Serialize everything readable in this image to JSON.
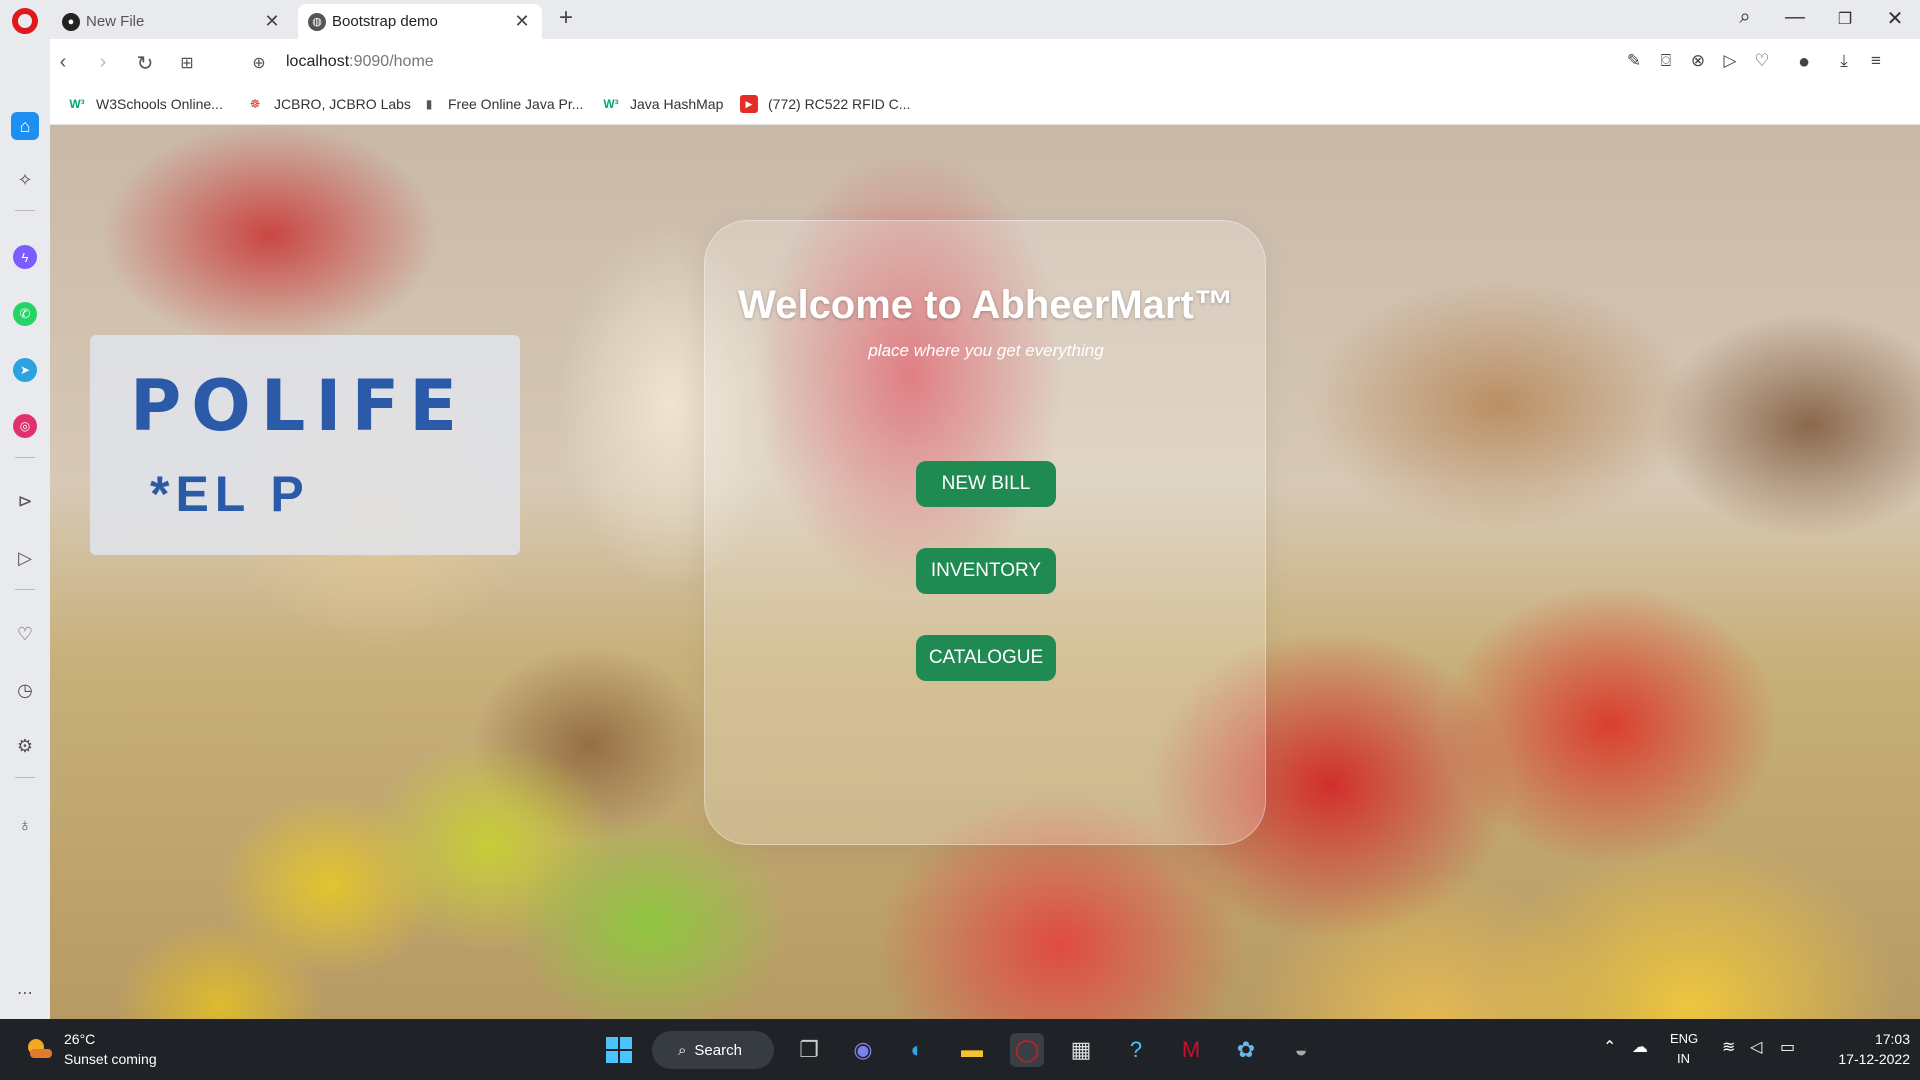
{
  "browser": {
    "tabs": [
      {
        "title": "New File",
        "icon": "github-icon"
      },
      {
        "title": "Bootstrap demo",
        "icon": "globe-icon"
      }
    ],
    "url_host": "localhost",
    "url_path": ":9090/home"
  },
  "bookmarks": [
    {
      "label": "W3Schools Online...",
      "icon": "w3schools-icon"
    },
    {
      "label": "JCBRO, JCBRO Labs",
      "icon": "jcbro-icon"
    },
    {
      "label": "Free Online Java Pr...",
      "icon": "page-icon"
    },
    {
      "label": "Java HashMap",
      "icon": "w3schools-icon"
    },
    {
      "label": "(772) RC522 RFID C...",
      "icon": "youtube-icon"
    }
  ],
  "background_sign": {
    "line1": "POLIFE",
    "line2": "*EL P"
  },
  "app": {
    "title": "Welcome to AbheerMart™",
    "tagline": "place where you get everything",
    "buttons": {
      "new_bill": "NEW BILL",
      "inventory": "INVENTORY",
      "catalogue": "CATALOGUE"
    },
    "accent_color": "#1f8a52"
  },
  "taskbar": {
    "temperature": "26°C",
    "weather": "Sunset coming",
    "search_label": "Search",
    "lang_line1": "ENG",
    "lang_line2": "IN",
    "time": "17:03",
    "date": "17-12-2022"
  }
}
